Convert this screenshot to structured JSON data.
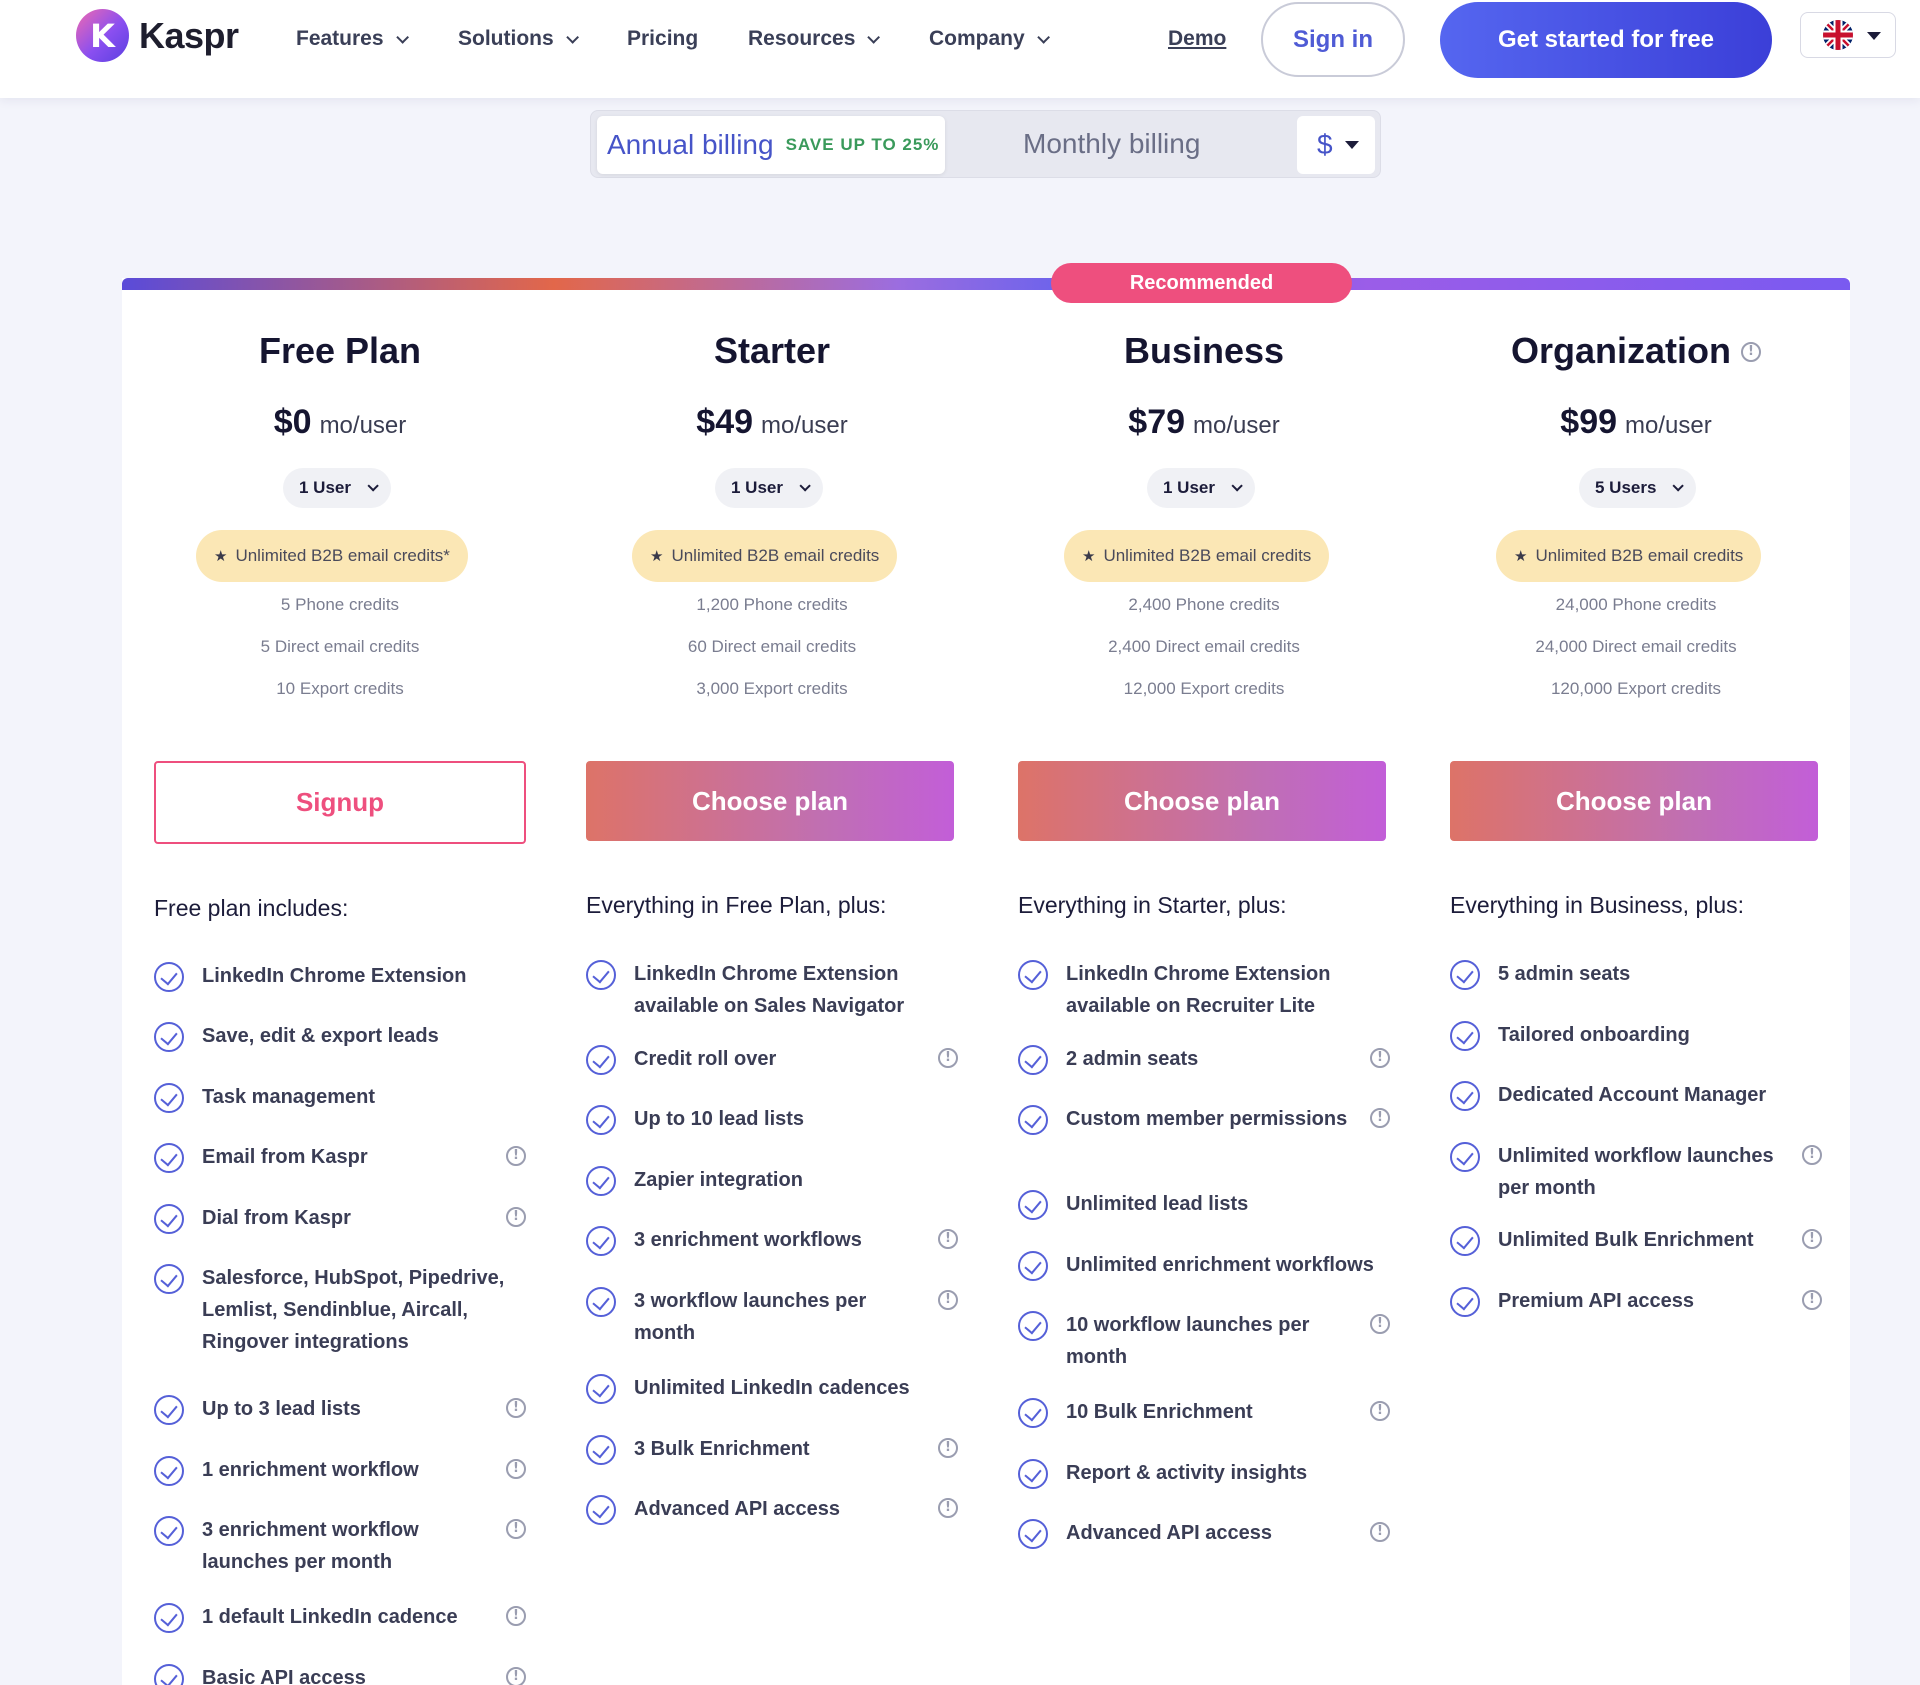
{
  "nav": {
    "logo_mark": "K",
    "logo_text": "Kaspr",
    "items": [
      {
        "label": "Features",
        "dropdown": true
      },
      {
        "label": "Solutions",
        "dropdown": true
      },
      {
        "label": "Pricing",
        "dropdown": false
      },
      {
        "label": "Resources",
        "dropdown": true
      },
      {
        "label": "Company",
        "dropdown": true
      }
    ],
    "demo": "Demo",
    "signin": "Sign in",
    "get_started": "Get started for free",
    "language_icon": "uk-flag-icon"
  },
  "billing": {
    "annual": "Annual billing",
    "save": "SAVE UP TO 25%",
    "monthly": "Monthly billing",
    "currency": "$",
    "selected": "annual"
  },
  "colors": {
    "accent": "#4f5bd5",
    "recommended": "#ee4f7e",
    "check": "#5560d8",
    "credit_pill": "#fbe7b5"
  },
  "recommended_label": "Recommended",
  "plans": [
    {
      "title": "Free Plan",
      "price": "$0",
      "unit": "mo/user",
      "users": "1 User",
      "unlimited": "Unlimited B2B email credits*",
      "credits": [
        "5 Phone credits",
        "5 Direct email credits",
        "10 Export credits"
      ],
      "cta": "Signup",
      "includes": "Free plan includes:",
      "features": [
        {
          "label": "LinkedIn Chrome Extension",
          "info": false
        },
        {
          "label": "Save, edit & export leads",
          "info": false
        },
        {
          "label": "Task management",
          "info": false
        },
        {
          "label": "Email from Kaspr",
          "info": true
        },
        {
          "label": "Dial from Kaspr",
          "info": true
        },
        {
          "label": "Salesforce, HubSpot, Pipedrive, Lemlist, Sendinblue, Aircall, Ringover integrations",
          "info": false
        },
        {
          "label": "Up to 3 lead lists",
          "info": true
        },
        {
          "label": "1 enrichment workflow",
          "info": true
        },
        {
          "label": "3 enrichment workflow launches per month",
          "info": true
        },
        {
          "label": "1 default LinkedIn cadence",
          "info": true
        },
        {
          "label": "Basic API access",
          "info": true
        }
      ]
    },
    {
      "title": "Starter",
      "price": "$49",
      "unit": "mo/user",
      "users": "1 User",
      "unlimited": "Unlimited B2B email credits",
      "credits": [
        "1,200 Phone credits",
        "60 Direct email credits",
        "3,000 Export credits"
      ],
      "cta": "Choose plan",
      "includes": "Everything in Free Plan, plus:",
      "features": [
        {
          "label": "LinkedIn Chrome Extension available on Sales Navigator",
          "info": false
        },
        {
          "label": "Credit roll over",
          "info": true
        },
        {
          "label": "Up to 10 lead lists",
          "info": false
        },
        {
          "label": "Zapier integration",
          "info": false
        },
        {
          "label": "3 enrichment workflows",
          "info": true
        },
        {
          "label": "3 workflow launches per month",
          "info": true
        },
        {
          "label": "Unlimited LinkedIn cadences",
          "info": false
        },
        {
          "label": "3 Bulk Enrichment",
          "info": true
        },
        {
          "label": "Advanced API access",
          "info": true
        }
      ]
    },
    {
      "title": "Business",
      "price": "$79",
      "unit": "mo/user",
      "users": "1 User",
      "unlimited": "Unlimited B2B email credits",
      "credits": [
        "2,400 Phone credits",
        "2,400 Direct email credits",
        "12,000 Export credits"
      ],
      "cta": "Choose plan",
      "includes": "Everything in Starter, plus:",
      "features": [
        {
          "label": "LinkedIn Chrome Extension available on Recruiter Lite",
          "info": false
        },
        {
          "label": "2 admin seats",
          "info": true
        },
        {
          "label": "Custom member permissions",
          "info": true
        },
        {
          "label": "Unlimited lead lists",
          "info": false
        },
        {
          "label": "Unlimited enrichment workflows",
          "info": false
        },
        {
          "label": "10 workflow launches per month",
          "info": true
        },
        {
          "label": "10 Bulk Enrichment",
          "info": true
        },
        {
          "label": "Report & activity insights",
          "info": false
        },
        {
          "label": "Advanced API access",
          "info": true
        }
      ]
    },
    {
      "title": "Organization",
      "price": "$99",
      "unit": "mo/user",
      "users": "5 Users",
      "unlimited": "Unlimited B2B email credits",
      "credits": [
        "24,000 Phone credits",
        "24,000 Direct email credits",
        "120,000 Export credits"
      ],
      "cta": "Choose plan",
      "includes": "Everything in Business, plus:",
      "features": [
        {
          "label": "5 admin seats",
          "info": false
        },
        {
          "label": "Tailored onboarding",
          "info": false
        },
        {
          "label": "Dedicated Account Manager",
          "info": false
        },
        {
          "label": "Unlimited workflow launches per month",
          "info": true
        },
        {
          "label": "Unlimited Bulk Enrichment",
          "info": true
        },
        {
          "label": "Premium API access",
          "info": true
        }
      ]
    }
  ]
}
